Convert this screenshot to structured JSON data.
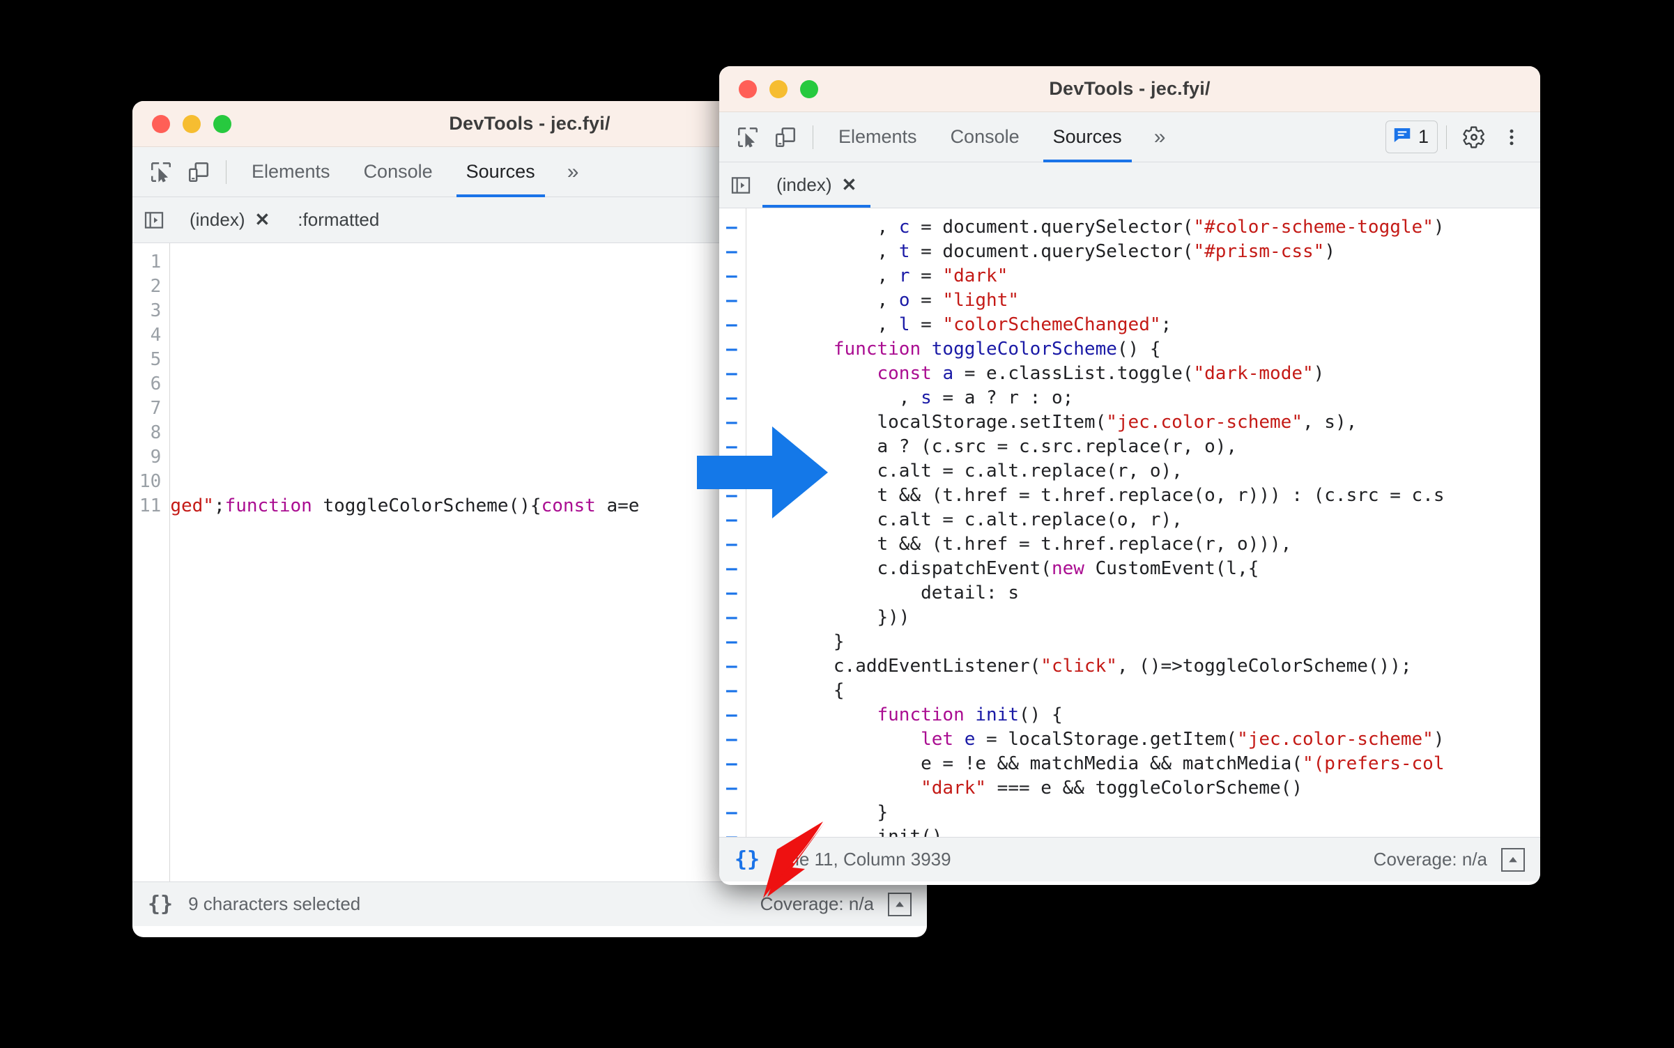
{
  "back_window": {
    "title": "DevTools - jec.fyi/",
    "traffic_lights": [
      "close-red",
      "minimize-yellow",
      "maximize-green"
    ],
    "toolbar": {
      "inspect_icon": "inspect-cursor-icon",
      "device_icon": "device-toolbar-icon",
      "tabs": [
        {
          "label": "Elements",
          "active": false
        },
        {
          "label": "Console",
          "active": false
        },
        {
          "label": "Sources",
          "active": true
        }
      ],
      "more_label": "»"
    },
    "file_strip": {
      "nav_icon": "navigator-panel-icon",
      "tabs": [
        {
          "label": "(index)",
          "close": "✕"
        }
      ],
      "sub_label": ":formatted"
    },
    "editor": {
      "line_numbers": [
        "1",
        "2",
        "3",
        "4",
        "5",
        "6",
        "7",
        "8",
        "9",
        "10",
        "11"
      ],
      "line11_segments": [
        {
          "text": "ged\"",
          "type": "str"
        },
        {
          "text": ";",
          "type": "plain"
        },
        {
          "text": "function",
          "type": "kw"
        },
        {
          "text": " toggleColorScheme(){",
          "type": "plain"
        },
        {
          "text": "const",
          "type": "kw"
        },
        {
          "text": " a=e",
          "type": "plain"
        }
      ]
    },
    "statusbar": {
      "pretty_print": "{}",
      "pretty_print_active": false,
      "status_text": "9 characters selected",
      "coverage": "Coverage: n/a",
      "drawer_icon": "drawer-toggle-icon"
    }
  },
  "front_window": {
    "title": "DevTools - jec.fyi/",
    "traffic_lights": [
      "close-red",
      "minimize-yellow",
      "maximize-green"
    ],
    "toolbar": {
      "inspect_icon": "inspect-cursor-icon",
      "device_icon": "device-toolbar-icon",
      "tabs": [
        {
          "label": "Elements",
          "active": false
        },
        {
          "label": "Console",
          "active": false
        },
        {
          "label": "Sources",
          "active": true
        }
      ],
      "more_label": "»",
      "issues_icon": "issues-message-icon",
      "issues_count": "1",
      "settings_icon": "gear-icon",
      "menu_icon": "more-vertical-icon"
    },
    "file_strip": {
      "nav_icon": "navigator-panel-icon",
      "tabs": [
        {
          "label": "(index)",
          "close": "✕",
          "active": true
        }
      ]
    },
    "editor": {
      "gutter_marker": "–",
      "line_count": 28,
      "lines": [
        [
          {
            "t": "            , ",
            "k": "p"
          },
          {
            "t": "c",
            "k": "v"
          },
          {
            "t": " = document.querySelector(",
            "k": "p"
          },
          {
            "t": "\"#color-scheme-toggle\"",
            "k": "s"
          },
          {
            "t": ")",
            "k": "p"
          }
        ],
        [
          {
            "t": "            , ",
            "k": "p"
          },
          {
            "t": "t",
            "k": "v"
          },
          {
            "t": " = document.querySelector(",
            "k": "p"
          },
          {
            "t": "\"#prism-css\"",
            "k": "s"
          },
          {
            "t": ")",
            "k": "p"
          }
        ],
        [
          {
            "t": "            , ",
            "k": "p"
          },
          {
            "t": "r",
            "k": "v"
          },
          {
            "t": " = ",
            "k": "p"
          },
          {
            "t": "\"dark\"",
            "k": "s"
          }
        ],
        [
          {
            "t": "            , ",
            "k": "p"
          },
          {
            "t": "o",
            "k": "v"
          },
          {
            "t": " = ",
            "k": "p"
          },
          {
            "t": "\"light\"",
            "k": "s"
          }
        ],
        [
          {
            "t": "            , ",
            "k": "p"
          },
          {
            "t": "l",
            "k": "v"
          },
          {
            "t": " = ",
            "k": "p"
          },
          {
            "t": "\"colorSchemeChanged\"",
            "k": "s"
          },
          {
            "t": ";",
            "k": "p"
          }
        ],
        [
          {
            "t": "        ",
            "k": "p"
          },
          {
            "t": "function",
            "k": "k"
          },
          {
            "t": " ",
            "k": "p"
          },
          {
            "t": "toggleColorScheme",
            "k": "f"
          },
          {
            "t": "() {",
            "k": "p"
          }
        ],
        [
          {
            "t": "            ",
            "k": "p"
          },
          {
            "t": "const",
            "k": "k"
          },
          {
            "t": " ",
            "k": "p"
          },
          {
            "t": "a",
            "k": "v"
          },
          {
            "t": " = e.classList.toggle(",
            "k": "p"
          },
          {
            "t": "\"dark-mode\"",
            "k": "s"
          },
          {
            "t": ")",
            "k": "p"
          }
        ],
        [
          {
            "t": "              , ",
            "k": "p"
          },
          {
            "t": "s",
            "k": "v"
          },
          {
            "t": " = a ? r : o;",
            "k": "p"
          }
        ],
        [
          {
            "t": "            localStorage.setItem(",
            "k": "p"
          },
          {
            "t": "\"jec.color-scheme\"",
            "k": "s"
          },
          {
            "t": ", s),",
            "k": "p"
          }
        ],
        [
          {
            "t": "            a ? (c.src = c.src.replace(r, o),",
            "k": "p"
          }
        ],
        [
          {
            "t": "            c.alt = c.alt.replace(r, o),",
            "k": "p"
          }
        ],
        [
          {
            "t": "            t && (t.href = t.href.replace(o, r))) : (c.src = c.s",
            "k": "p"
          }
        ],
        [
          {
            "t": "            c.alt = c.alt.replace(o, r),",
            "k": "p"
          }
        ],
        [
          {
            "t": "            t && (t.href = t.href.replace(r, o))),",
            "k": "p"
          }
        ],
        [
          {
            "t": "            c.dispatchEvent(",
            "k": "p"
          },
          {
            "t": "new",
            "k": "k"
          },
          {
            "t": " CustomEvent(l,{",
            "k": "p"
          }
        ],
        [
          {
            "t": "                detail: s",
            "k": "p"
          }
        ],
        [
          {
            "t": "            }))",
            "k": "p"
          }
        ],
        [
          {
            "t": "        }",
            "k": "p"
          }
        ],
        [
          {
            "t": "        c.addEventListener(",
            "k": "p"
          },
          {
            "t": "\"click\"",
            "k": "s"
          },
          {
            "t": ", ()=>toggleColorScheme());",
            "k": "p"
          }
        ],
        [
          {
            "t": "        {",
            "k": "p"
          }
        ],
        [
          {
            "t": "            ",
            "k": "p"
          },
          {
            "t": "function",
            "k": "k"
          },
          {
            "t": " ",
            "k": "p"
          },
          {
            "t": "init",
            "k": "f"
          },
          {
            "t": "() {",
            "k": "p"
          }
        ],
        [
          {
            "t": "                ",
            "k": "p"
          },
          {
            "t": "let",
            "k": "k"
          },
          {
            "t": " ",
            "k": "p"
          },
          {
            "t": "e",
            "k": "v"
          },
          {
            "t": " = localStorage.getItem(",
            "k": "p"
          },
          {
            "t": "\"jec.color-scheme\"",
            "k": "s"
          },
          {
            "t": ")",
            "k": "p"
          }
        ],
        [
          {
            "t": "                e = !e && matchMedia && matchMedia(",
            "k": "p"
          },
          {
            "t": "\"(prefers-col",
            "k": "s"
          }
        ],
        [
          {
            "t": "                ",
            "k": "p"
          },
          {
            "t": "\"dark\"",
            "k": "s"
          },
          {
            "t": " === e && toggleColorScheme()",
            "k": "p"
          }
        ],
        [
          {
            "t": "            }",
            "k": "p"
          }
        ],
        [
          {
            "t": "            init()",
            "k": "p"
          }
        ],
        [
          {
            "t": "        }",
            "k": "p"
          }
        ],
        [
          {
            "t": "    }",
            "k": "p"
          }
        ]
      ]
    },
    "statusbar": {
      "pretty_print": "{}",
      "pretty_print_active": true,
      "status_text": "Line 11, Column 3939",
      "coverage": "Coverage: n/a",
      "drawer_icon": "drawer-toggle-icon"
    }
  },
  "annotations": {
    "blue_arrow": {
      "name": "blue-transition-arrow",
      "color": "#1478e8",
      "direction": "right"
    },
    "red_arrow": {
      "name": "red-pointer-arrow",
      "color": "#ee1111",
      "direction": "down-left",
      "points_at": "pretty-print-button"
    }
  },
  "colors": {
    "titlebar_bg": "#faefe9",
    "toolbar_bg": "#f1f3f4",
    "accent_blue": "#1a73e8",
    "string_red": "#c41a16",
    "keyword_magenta": "#aa0d91",
    "variable_blue": "#1a1aa6",
    "desktop_bg": "#000000"
  }
}
